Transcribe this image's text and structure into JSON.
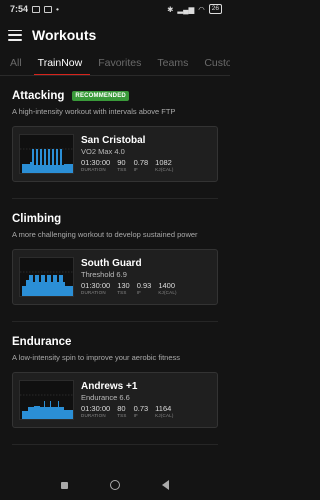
{
  "status": {
    "time": "7:54",
    "battery": "26"
  },
  "app": {
    "title": "Workouts"
  },
  "tabs": [
    "All",
    "TrainNow",
    "Favorites",
    "Teams",
    "Custom"
  ],
  "sections": [
    {
      "title": "Attacking",
      "badge": "RECOMMENDED",
      "description": "A high-intensity workout with intervals above FTP",
      "workout": {
        "name": "San Cristobal",
        "subtitle": "VO2 Max 4.0",
        "duration": "01:30:00",
        "tss": "90",
        "if": "0.78",
        "kj": "1082"
      }
    },
    {
      "title": "Climbing",
      "badge": "",
      "description": "A more challenging workout to develop sustained power",
      "workout": {
        "name": "South Guard",
        "subtitle": "Threshold 6.9",
        "duration": "01:30:00",
        "tss": "130",
        "if": "0.93",
        "kj": "1400"
      }
    },
    {
      "title": "Endurance",
      "badge": "",
      "description": "A low-intensity spin to improve your aerobic fitness",
      "workout": {
        "name": "Andrews +1",
        "subtitle": "Endurance 6.6",
        "duration": "01:30:00",
        "tss": "80",
        "if": "0.73",
        "kj": "1164"
      }
    }
  ],
  "stat_labels": {
    "duration": "DURATION",
    "tss": "TSS",
    "if": "IF",
    "kj": "KJ(CAL)"
  },
  "colors": {
    "accent": "#d6241c",
    "badge": "#3a9a3a",
    "profile": "#2b8fd6"
  }
}
